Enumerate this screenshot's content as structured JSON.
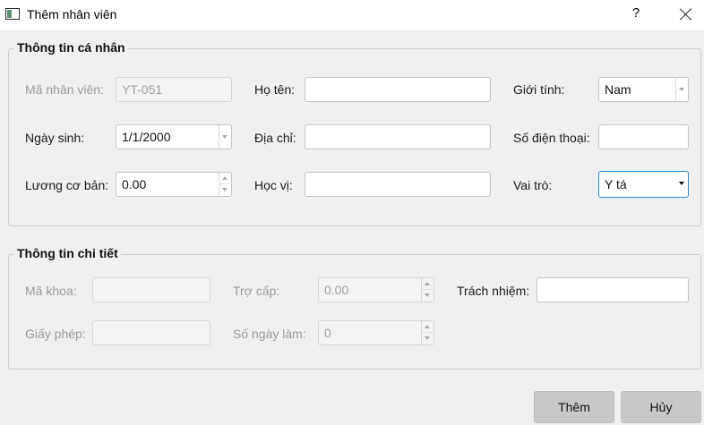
{
  "window": {
    "title": "Thêm nhân viên",
    "help": "?"
  },
  "personal": {
    "title": "Thông tin cá nhân",
    "employee_id_label": "Mã nhân viên:",
    "employee_id_value": "YT-051",
    "full_name_label": "Họ tên:",
    "full_name_value": "",
    "gender_label": "Giới tính:",
    "gender_value": "Nam",
    "birthdate_label": "Ngày sinh:",
    "birthdate_value": "1/1/2000",
    "address_label": "Địa chỉ:",
    "address_value": "",
    "phone_label": "Số điện thoại:",
    "phone_value": "",
    "salary_label": "Lương cơ bản:",
    "salary_value": "0.00",
    "degree_label": "Học vị:",
    "degree_value": "",
    "role_label": "Vai trò:",
    "role_value": "Y tá"
  },
  "details": {
    "title": "Thông tin chi tiết",
    "department_label": "Mã khoa:",
    "department_value": "",
    "allowance_label": "Trợ cấp:",
    "allowance_value": "0.00",
    "responsibility_label": "Trách nhiệm:",
    "responsibility_value": "",
    "license_label": "Giấy phép:",
    "license_value": "",
    "workdays_label": "Số ngày làm:",
    "workdays_value": "0"
  },
  "buttons": {
    "add": "Thêm",
    "cancel": "Hủy"
  },
  "colors": {
    "focus_border": "#2f8ad6",
    "button_bg": "#c8c8c8",
    "dialog_bg": "#f0f0f0"
  }
}
